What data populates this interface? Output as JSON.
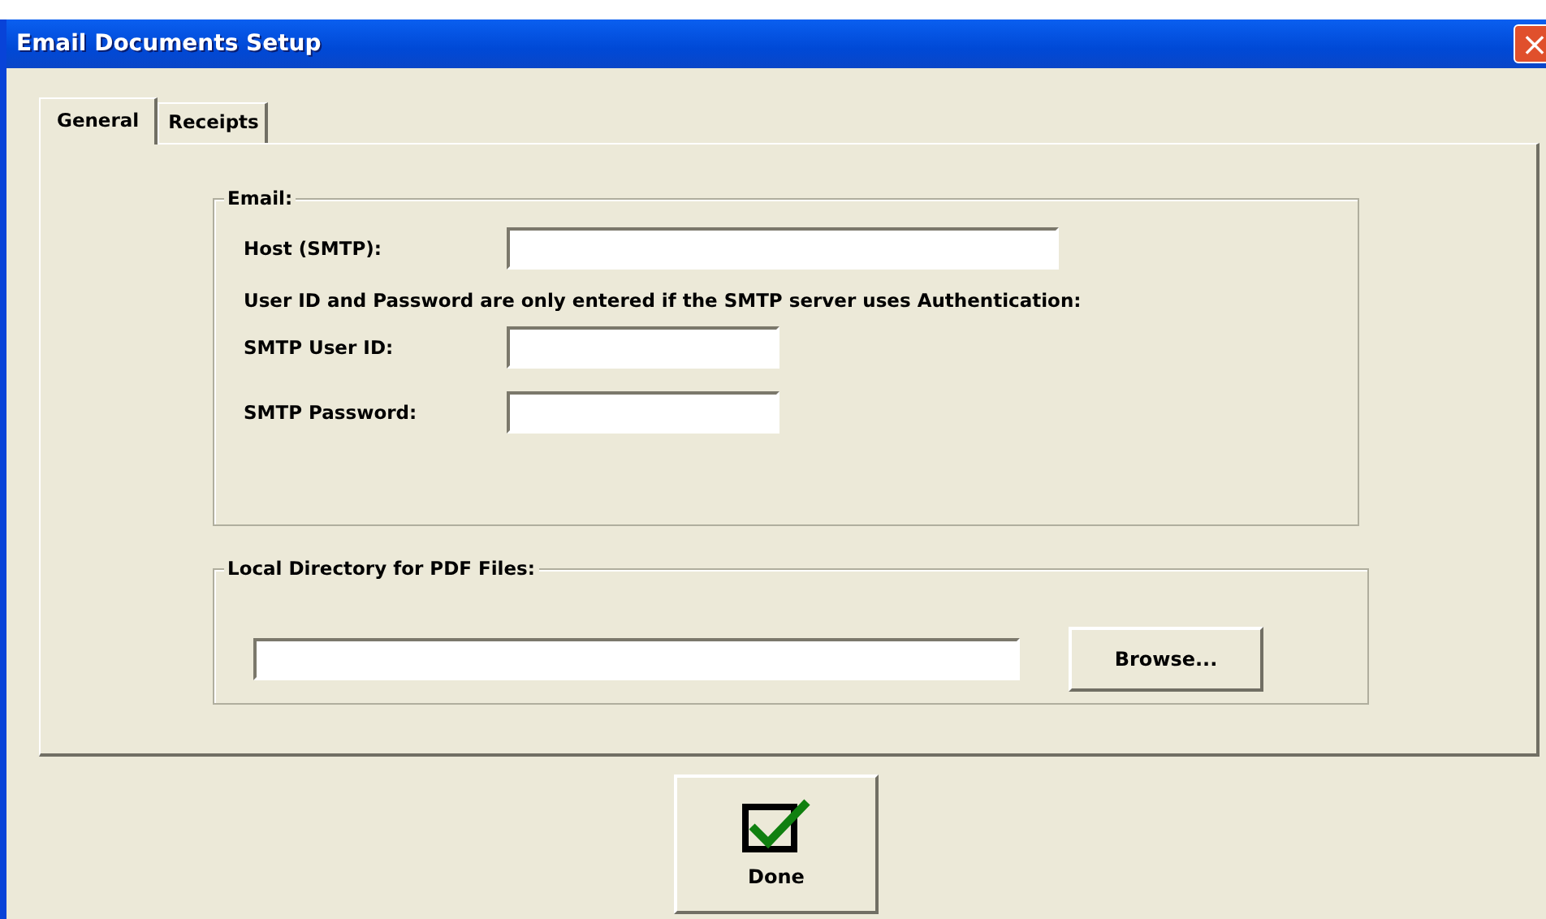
{
  "window": {
    "title": "Email Documents Setup",
    "close": "×"
  },
  "tabs": [
    {
      "label": "General",
      "selected": true
    },
    {
      "label": "Receipts",
      "selected": false
    }
  ],
  "email_group": {
    "legend": "Email:",
    "host_label": "Host (SMTP):",
    "note": "User ID and Password are only entered if the SMTP server uses Authentication:",
    "user_label": "SMTP User ID:",
    "password_label": "SMTP Password:"
  },
  "pdf_group": {
    "legend": "Local Directory for PDF Files:",
    "browse": "Browse..."
  },
  "done_button": "Done"
}
